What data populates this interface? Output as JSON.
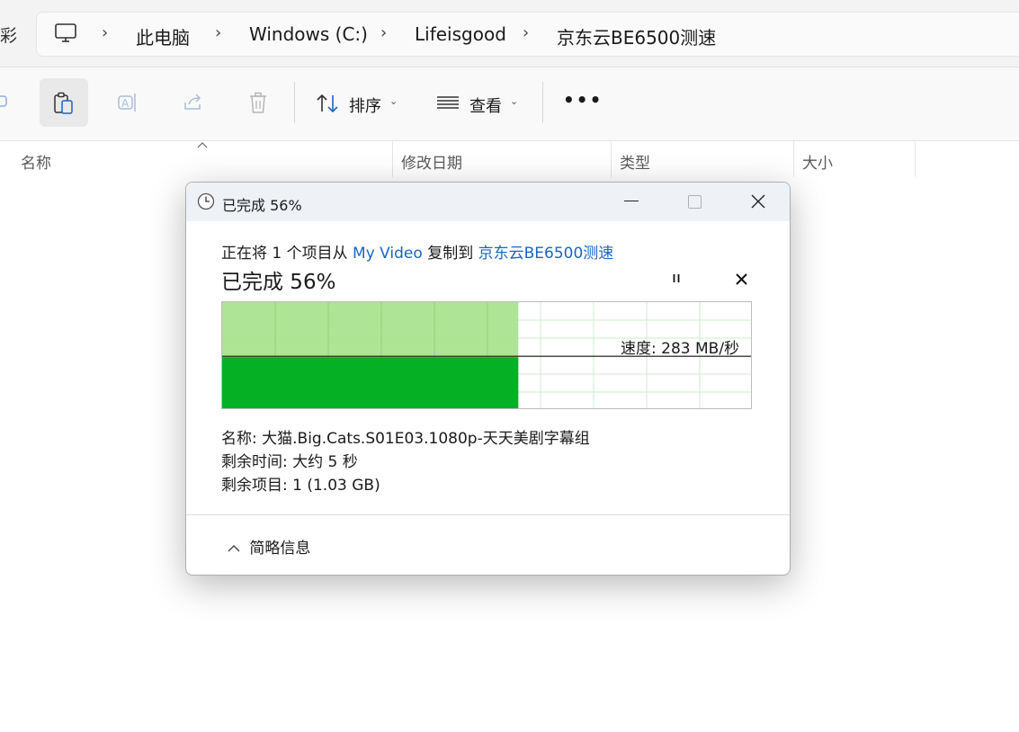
{
  "explorer": {
    "left_edge_glyph": "彩",
    "breadcrumb": [
      "此电脑",
      "Windows (C:)",
      "Lifeisgood",
      "京东云BE6500测速"
    ],
    "breadcrumb_separator": "›",
    "toolbar": {
      "sort_label": "排序",
      "view_label": "查看",
      "more_label": "•••",
      "caret": "⌄"
    },
    "columns": {
      "name": "名称",
      "modified": "修改日期",
      "type": "类型",
      "size": "大小"
    }
  },
  "dialog": {
    "title": "已完成 56%",
    "copy_prefix": "正在将 1 个项目从 ",
    "copy_source": "My Video",
    "copy_middle": " 复制到 ",
    "copy_destination": "京东云BE6500测速",
    "progress_heading": "已完成 56%",
    "progress_fraction": 0.56,
    "speed_label": "速度: 283 MB/秒",
    "speed_line_level": 0.49,
    "details": {
      "name": "名称: 大猫.Big.Cats.S01E03.1080p-天天美剧字幕组",
      "remaining_time": "剩余时间: 大约 5 秒",
      "remaining_items": "剩余项目: 1 (1.03 GB)"
    },
    "fewer_details": "简略信息",
    "colors": {
      "graph_light": "#a9e38f",
      "graph_dark": "#06b025",
      "grid": "#cfe8d1",
      "link": "#1a66c2"
    }
  }
}
